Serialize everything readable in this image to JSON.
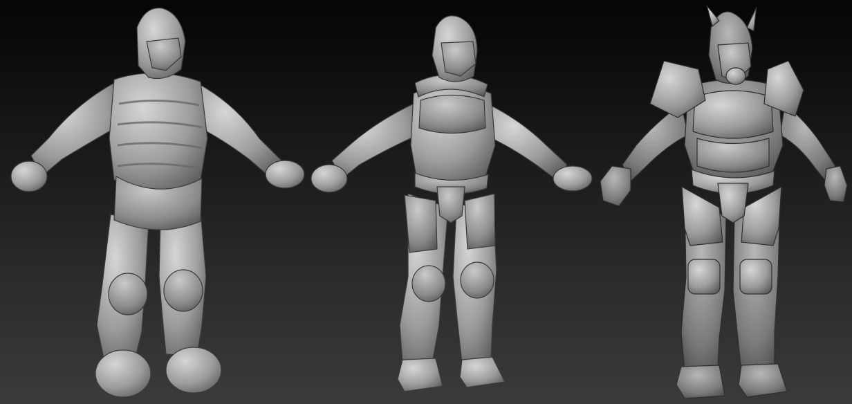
{
  "viewport": {
    "models": [
      {
        "id": "model-stage-1",
        "stage": "rough-blockout"
      },
      {
        "id": "model-stage-2",
        "stage": "refined-sculpt"
      },
      {
        "id": "model-stage-3",
        "stage": "detailed-armor"
      }
    ],
    "colors": {
      "background_top": "#050505",
      "background_bottom": "#3b3b3b",
      "clay_light": "#cfcfcf",
      "clay_mid": "#9a9a9a",
      "clay_dark": "#4e4e4e"
    }
  }
}
